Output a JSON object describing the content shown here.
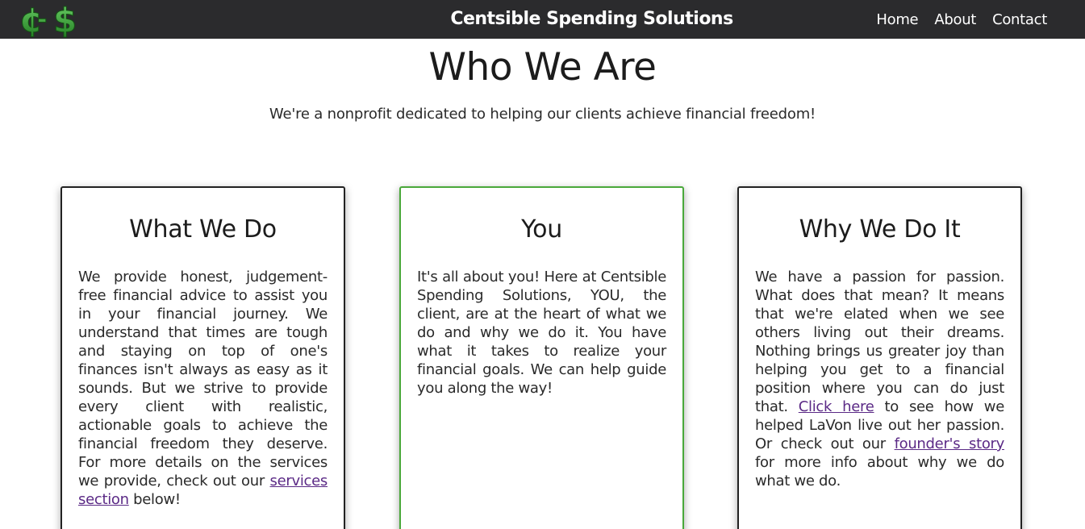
{
  "nav": {
    "brand": "Centsible Spending Solutions",
    "links": [
      "Home",
      "About",
      "Contact"
    ],
    "logo_icon": "cents-dollar-logo-icon"
  },
  "hero": {
    "title": "Who We Are",
    "subtitle": "We're a nonprofit dedicated to helping our clients achieve financial freedom!"
  },
  "cards": [
    {
      "title": "What We Do",
      "text_before": "We provide honest, judgement-free financial advice to assist you in your financial journey. We understand that times are tough and staying on top of one's finances isn't always as easy as it sounds. But we strive to provide every client with realistic, actionable goals to achieve the financial freedom they deserve. For more details on the services we provide, check out our ",
      "link": "services section",
      "text_after": " below!"
    },
    {
      "title": "You",
      "text": "It's all about you! Here at Centsible Spending Solutions, YOU, the client, are at the heart of what we do and why we do it. You have what it takes to realize your financial goals. We can help guide you along the way!"
    },
    {
      "title": "Why We Do It",
      "text_before": "We have a passion for passion. What does that mean? It means that we're elated when we see others living out their dreams. Nothing brings us greater joy than helping you get to a financial position where you can do just that. ",
      "link1": "Click here",
      "text_middle": " to see how we helped LaVon live out her passion. Or check out our ",
      "link2": "founder's story",
      "text_after": " for more info about why we do what we do."
    }
  ],
  "colors": {
    "navbar": "#2b2b2d",
    "featured_border": "#4aa83a",
    "link": "#5b2a86",
    "logo_green": "#2e8b2e"
  }
}
